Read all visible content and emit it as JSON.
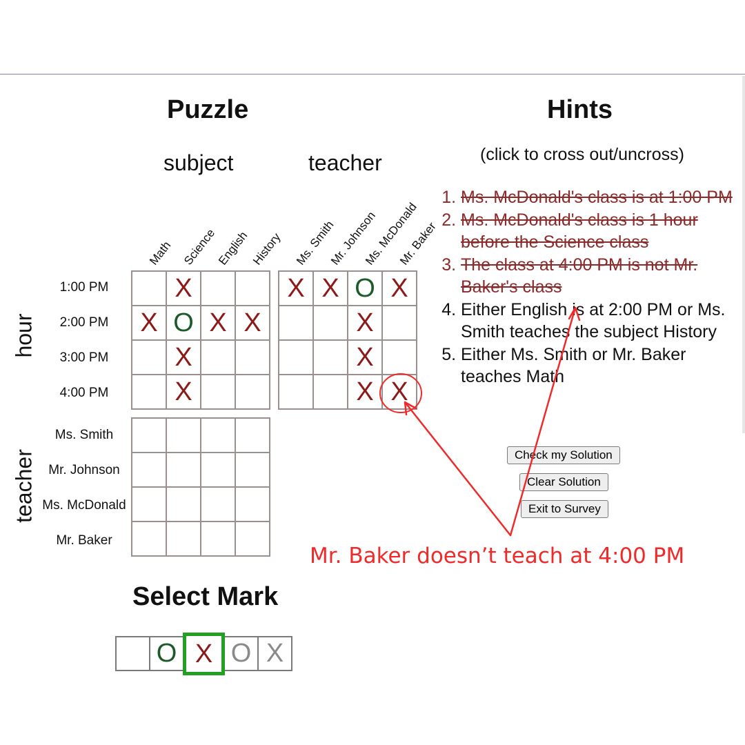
{
  "puzzle": {
    "title": "Puzzle",
    "col_groups": [
      "subject",
      "teacher"
    ],
    "subjects": [
      "Math",
      "Science",
      "English",
      "History"
    ],
    "teachers": [
      "Ms. Smith",
      "Mr. Johnson",
      "Ms. McDonald",
      "Mr. Baker"
    ],
    "hours": [
      "1:00 PM",
      "2:00 PM",
      "3:00 PM",
      "4:00 PM"
    ],
    "row_groups": [
      "hour",
      "teacher"
    ],
    "hour_subject": [
      [
        "",
        "X",
        "",
        ""
      ],
      [
        "X",
        "O",
        "X",
        "X"
      ],
      [
        "",
        "X",
        "",
        ""
      ],
      [
        "",
        "X",
        "",
        ""
      ]
    ],
    "hour_teacher": [
      [
        "X",
        "X",
        "O",
        "X"
      ],
      [
        "",
        "",
        "X",
        ""
      ],
      [
        "",
        "",
        "X",
        ""
      ],
      [
        "",
        "",
        "X",
        "X"
      ]
    ],
    "teacher_subject": [
      [
        "",
        "",
        "",
        ""
      ],
      [
        "",
        "",
        "",
        ""
      ],
      [
        "",
        "",
        "",
        ""
      ],
      [
        "",
        "",
        "",
        ""
      ]
    ]
  },
  "hints": {
    "title": "Hints",
    "subtitle": "(click to cross out/uncross)",
    "items": [
      {
        "text": "Ms. McDonald's class is at 1:00 PM",
        "crossed": true
      },
      {
        "text": "Ms. McDonald's class is 1 hour before the Science class",
        "crossed": true
      },
      {
        "text": "The class at 4:00 PM is not Mr. Baker's class",
        "crossed": true
      },
      {
        "text": "Either English is at 2:00 PM or Ms. Smith teaches the subject History",
        "crossed": false
      },
      {
        "text": "Either Ms. Smith or Mr. Baker teaches Math",
        "crossed": false
      }
    ]
  },
  "buttons": {
    "check": "Check my Solution",
    "clear": "Clear Solution",
    "exit": "Exit to Survey"
  },
  "select_mark": {
    "title": "Select Mark",
    "options": [
      {
        "glyph": "",
        "style": "blank",
        "selected": false
      },
      {
        "glyph": "O",
        "style": "O",
        "selected": false
      },
      {
        "glyph": "X",
        "style": "X",
        "selected": true
      },
      {
        "glyph": "O",
        "style": "gO",
        "selected": false
      },
      {
        "glyph": "X",
        "style": "gX",
        "selected": false
      }
    ]
  },
  "annotation": {
    "text": "Mr. Baker doesn’t teach at 4:00 PM",
    "color": "#f02a2a"
  },
  "colors": {
    "mark_x": "#8b1a1a",
    "mark_o": "#1d5a2a",
    "selected_border": "#22a022",
    "crossed_hint": "#8b2a2a"
  }
}
